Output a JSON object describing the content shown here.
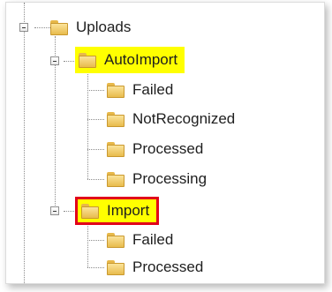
{
  "tree": {
    "root": {
      "label": "Uploads",
      "icon": "folder-icon",
      "expanded": true
    },
    "autoimport": {
      "label": "AutoImport",
      "icon": "folder-icon",
      "expanded": true,
      "highlight": "#ffff00",
      "children": [
        "Failed",
        "NotRecognized",
        "Processed",
        "Processing"
      ]
    },
    "import": {
      "label": "Import",
      "icon": "folder-icon",
      "expanded": true,
      "highlight": "#ffff00",
      "highlight_border": "#e1001a",
      "children": [
        "Failed",
        "Processed"
      ]
    }
  },
  "colors": {
    "folder": "#e8bb4c",
    "connector": "#8c8c8c"
  }
}
